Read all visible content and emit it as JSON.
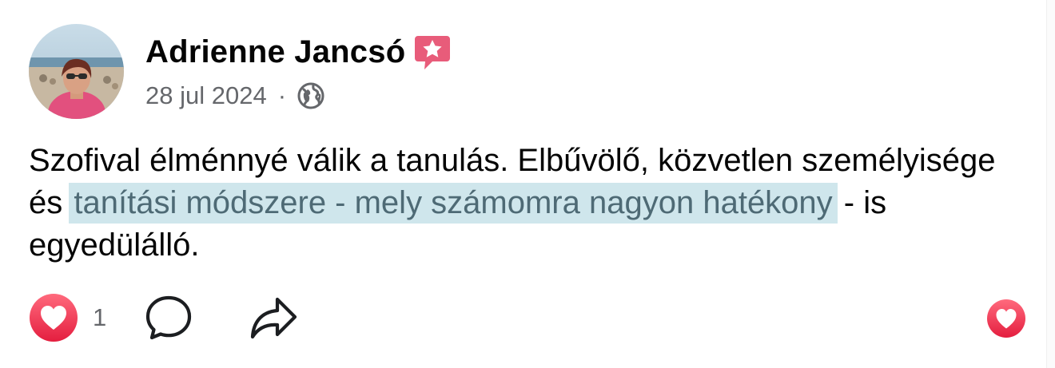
{
  "post": {
    "author": {
      "name": "Adrienne Jancsó",
      "badge_icon": "star-badge-icon",
      "avatar_icon": "profile-photo-avatar"
    },
    "meta": {
      "date": "28 jul 2024",
      "separator": "·",
      "audience_icon": "globe-icon"
    },
    "text": {
      "part1": "Szofival élménnyé válik a tanulás. Elbűvölő, közvetlen személyisége és ",
      "highlight": "tanítási módszere - mely számomra nagyon hatékony",
      "part2": " - is egyedülálló."
    },
    "actions": {
      "like_icon": "heart-icon",
      "like_count": "1",
      "comment_icon": "comment-bubble-icon",
      "share_icon": "share-arrow-icon",
      "reaction_icon": "heart-reaction-icon"
    },
    "colors": {
      "accent": "#f02849",
      "badge": "#e85c7a",
      "highlight_bg": "#cfe6ec",
      "highlight_text": "#4e6a75",
      "secondary_text": "#65676b"
    }
  }
}
